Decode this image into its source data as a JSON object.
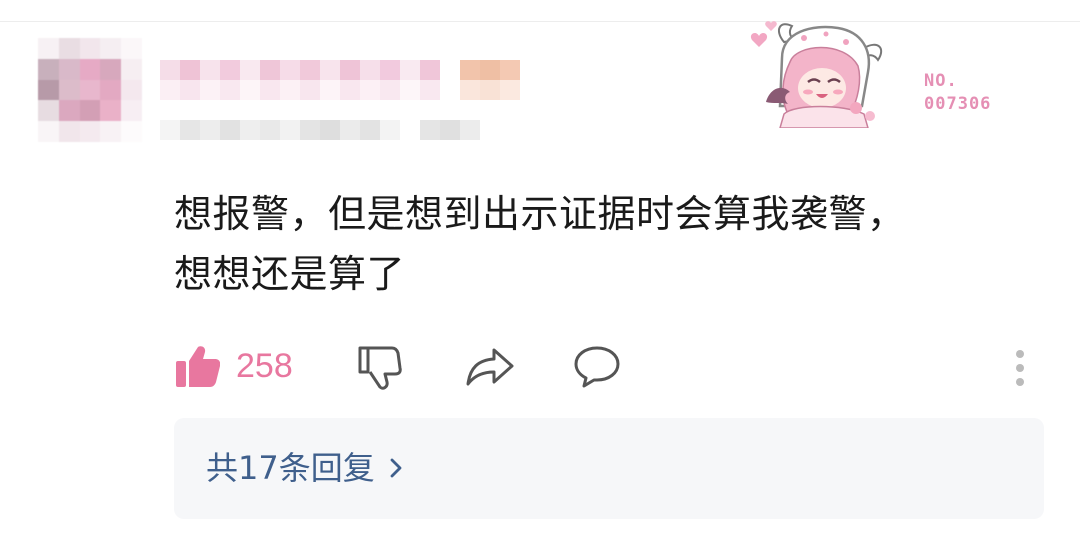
{
  "comment": {
    "text_line1": "想报警，但是想到出示证据时会算我袭警，",
    "text_line2": "想想还是算了"
  },
  "badge": {
    "label": "NO.",
    "number": "007306"
  },
  "actions": {
    "like_count": "258",
    "like_icon": "thumbs-up-icon",
    "dislike_icon": "thumbs-down-icon",
    "share_icon": "share-icon",
    "comment_icon": "comment-icon",
    "more_icon": "more-vertical-icon"
  },
  "replies": {
    "label": "共17条回复"
  },
  "colors": {
    "accent_pink": "#e8779f",
    "reply_link": "#3f5f8c",
    "reply_bg": "#f6f7f9"
  }
}
